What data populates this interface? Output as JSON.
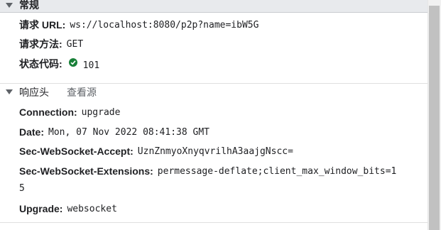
{
  "general": {
    "title": "常规",
    "request_url_label": "请求 URL:",
    "request_url_value": "ws://localhost:8080/p2p?name=ibW5G",
    "method_label": "请求方法:",
    "method_value": "GET",
    "status_label": "状态代码:",
    "status_value": "101",
    "status_color": "#188038"
  },
  "response_headers": {
    "title": "响应头",
    "view_source": "查看源",
    "items": [
      {
        "key": "Connection:",
        "value": "upgrade"
      },
      {
        "key": "Date:",
        "value": "Mon, 07 Nov 2022 08:41:38 GMT"
      },
      {
        "key": "Sec-WebSocket-Accept:",
        "value": "UznZnmyoXnyqvrilhA3aajgNscc="
      },
      {
        "key": "Sec-WebSocket-Extensions:",
        "value": "permessage-deflate;client_max_window_bits=1"
      },
      {
        "key": "Upgrade:",
        "value": "websocket"
      }
    ],
    "extensions_wrap": "5"
  }
}
